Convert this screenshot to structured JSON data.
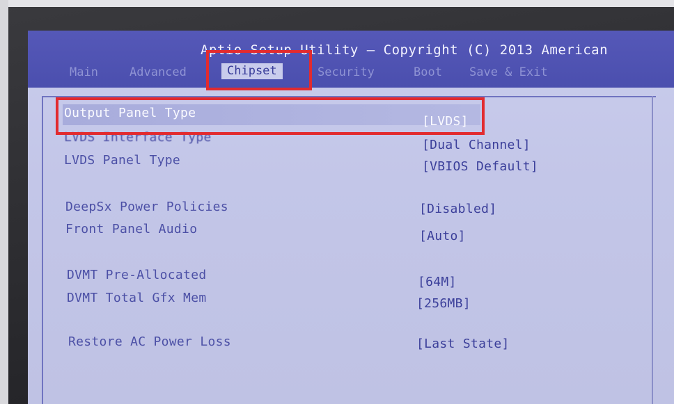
{
  "header": {
    "title": "Aptio Setup Utility – Copyright (C) 2013 American"
  },
  "tabs": [
    {
      "label": "Main",
      "active": false
    },
    {
      "label": "Advanced",
      "active": false
    },
    {
      "label": "Chipset",
      "active": true
    },
    {
      "label": "Security",
      "active": false
    },
    {
      "label": "Boot",
      "active": false
    },
    {
      "label": "Save & Exit",
      "active": false
    }
  ],
  "settings": [
    {
      "label": "Output Panel Type",
      "value": "[LVDS]",
      "selected": true
    },
    {
      "label": "LVDS Interface Type",
      "value": "[Dual Channel]",
      "selected": false
    },
    {
      "label": "LVDS Panel Type",
      "value": "[VBIOS Default]",
      "selected": false
    },
    {
      "label": "DeepSx Power Policies",
      "value": "[Disabled]",
      "selected": false
    },
    {
      "label": "Front Panel Audio",
      "value": "[Auto]",
      "selected": false
    },
    {
      "label": "DVMT Pre-Allocated",
      "value": "[64M]",
      "selected": false
    },
    {
      "label": "DVMT Total Gfx Mem",
      "value": "[256MB]",
      "selected": false
    },
    {
      "label": "Restore AC Power Loss",
      "value": "[Last State]",
      "selected": false
    }
  ],
  "colors": {
    "background": "#c9ccec",
    "titlebar": "#4b4fae",
    "label_text": "#4c50a6",
    "annotation_box": "#e22b2f"
  }
}
